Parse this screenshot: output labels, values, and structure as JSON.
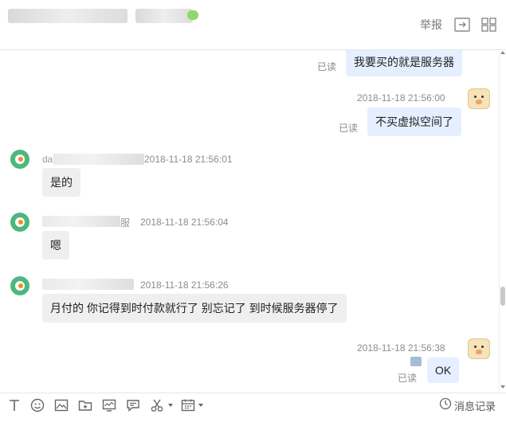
{
  "header": {
    "report_label": "举报"
  },
  "messages": {
    "m1": {
      "read_status": "已读",
      "text": "我要买的就是服务器"
    },
    "m2": {
      "timestamp": "2018-11-18 21:56:00",
      "read_status": "已读",
      "text": "不买虚拟空间了"
    },
    "m3": {
      "sender_prefix": "da",
      "sender_suffix": "",
      "timestamp": "2018-11-18 21:56:01",
      "text": "是的"
    },
    "m4": {
      "sender_suffix": "服",
      "timestamp": "2018-11-18 21:56:04",
      "text": "嗯"
    },
    "m5": {
      "timestamp": "2018-11-18 21:56:26",
      "text": "月付的 你记得到时付款就行了 别忘记了 到时候服务器停了"
    },
    "m6": {
      "timestamp": "2018-11-18 21:56:38",
      "read_status": "已读",
      "text": "OK"
    }
  },
  "toolbar": {
    "history_label": "消息记录"
  }
}
